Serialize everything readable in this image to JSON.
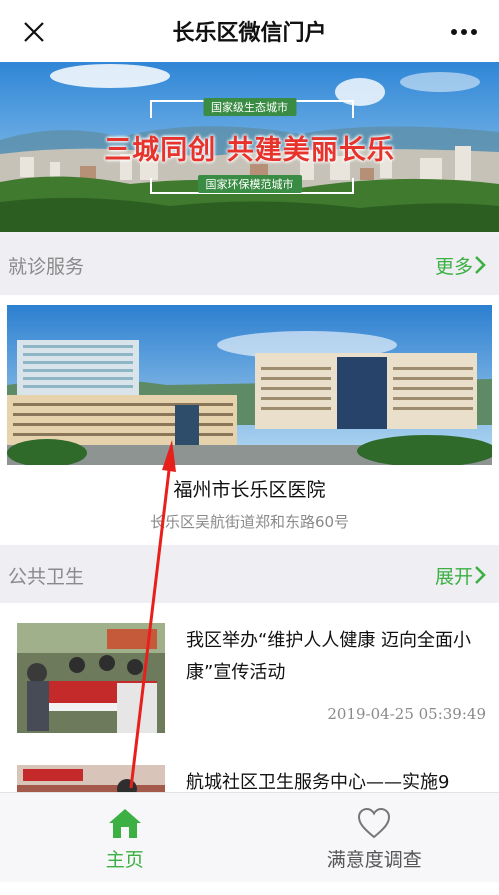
{
  "header": {
    "title": "长乐区微信门户",
    "close_icon": "close-icon",
    "more_icon": "more-dots-icon"
  },
  "banner": {
    "top_tag": "国家级生态城市",
    "slogan": "三城同创  共建美丽长乐",
    "bottom_tag": "国家环保模范城市"
  },
  "clinic_section": {
    "title": "就诊服务",
    "more_label": "更多"
  },
  "hospital": {
    "name": "福州市长乐区医院",
    "address": "长乐区吴航街道郑和东路60号"
  },
  "health_section": {
    "title": "公共卫生",
    "more_label": "展开"
  },
  "news": [
    {
      "title": "我区举办“维护人人健康 迈向全面小康”宣传活动",
      "date": "2019-04-25 05:39:49"
    },
    {
      "title": "航城社区卫生服务中心——实施9"
    }
  ],
  "tabbar": {
    "home_label": "主页",
    "survey_label": "满意度调查"
  },
  "colors": {
    "accent_green": "#3cb043",
    "slogan_red": "#e8322c",
    "annotation_red": "#e8201c"
  }
}
